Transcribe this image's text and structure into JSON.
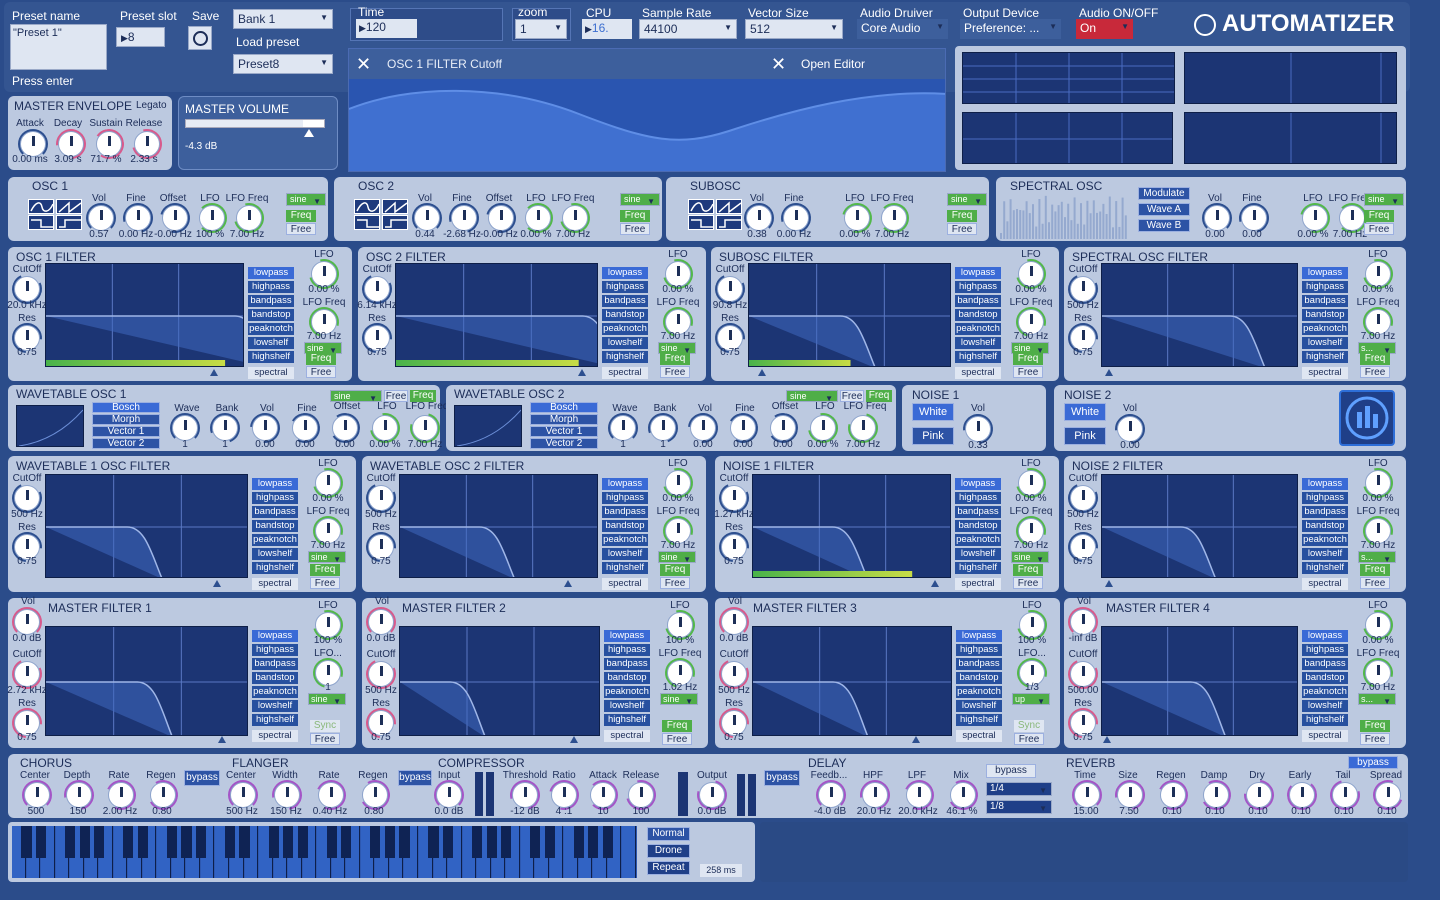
{
  "colors": {
    "bg": "#2b4c8a",
    "panel": "#bcc9e0",
    "accent_green": "#52b84a",
    "accent_pink": "#d85a8c",
    "accent_purple": "#a455c7",
    "graph": "#1c3574"
  },
  "top": {
    "preset_name_label": "Preset name",
    "preset_name_value": "\"Preset 1\"",
    "press_enter": "Press enter",
    "preset_slot_label": "Preset slot",
    "preset_slot_value": "8",
    "save_label": "Save",
    "bank_value": "Bank 1",
    "load_preset_label": "Load preset",
    "preset_value": "Preset8",
    "time_label": "Time",
    "time_value": "120",
    "zoom_label": "zoom",
    "zoom_value": "1",
    "cpu_label": "CPU",
    "cpu_value": "16.",
    "sample_rate_label": "Sample Rate",
    "sample_rate_value": "44100",
    "vector_size_label": "Vector Size",
    "vector_size_value": "512",
    "audio_driver_label": "Audio Druiver",
    "audio_driver_value": "Core Audio",
    "output_device_label": "Output Device",
    "output_device_value": "Preference: ...",
    "audio_onoff_label": "Audio ON/OFF",
    "audio_onoff_value": "On",
    "app_title": "AUTOMATIZER"
  },
  "editor": {
    "param_name": "OSC 1 FILTER Cutoff",
    "open_editor": "Open Editor"
  },
  "master_envelope": {
    "title": "MASTER ENVELOPE",
    "mode": "Legato",
    "knobs": [
      {
        "label": "Attack",
        "value": "0.00 ms"
      },
      {
        "label": "Decay",
        "value": "3.09 s"
      },
      {
        "label": "Sustain",
        "value": "71.7 %"
      },
      {
        "label": "Release",
        "value": "2.33 s"
      }
    ]
  },
  "master_volume": {
    "title": "MASTER VOLUME",
    "value": "-4.3 dB",
    "level": 0.85
  },
  "osc": [
    {
      "title": "OSC 1",
      "labels": [
        "Vol",
        "Fine",
        "Offset",
        "LFO",
        "LFO Freq"
      ],
      "values": [
        "0.57",
        "0.00 Hz",
        "-0.00 Hz",
        "100 %",
        "7.00 Hz"
      ],
      "wave": "sine",
      "freq": "Freq",
      "free": "Free"
    },
    {
      "title": "OSC 2",
      "labels": [
        "Vol",
        "Fine",
        "Offset",
        "LFO",
        "LFO Freq"
      ],
      "values": [
        "0.44",
        "-2.68 Hz",
        "-0.00 Hz",
        "0.00 %",
        "7.00 Hz"
      ],
      "wave": "sine",
      "freq": "Freq",
      "free": "Free"
    },
    {
      "title": "SUBOSC",
      "labels": [
        "Vol",
        "Fine",
        "LFO",
        "LFO Freq"
      ],
      "values": [
        "0.38",
        "0.00 Hz",
        "0.00 %",
        "7.00 Hz"
      ],
      "wave": "sine",
      "freq": "Freq",
      "free": "Free"
    },
    {
      "title": "SPECTRAL OSC",
      "labels": [
        "Vol",
        "Fine",
        "LFO",
        "LFO Freq"
      ],
      "values": [
        "0.00",
        "0.00",
        "0.00 %",
        "7.00 Hz"
      ],
      "wave": "sine",
      "freq": "Freq",
      "free": "Free",
      "buttons": [
        "Modulate",
        "Wave A",
        "Wave B"
      ]
    }
  ],
  "filter_types": [
    "lowpass",
    "highpass",
    "bandpass",
    "bandstop",
    "peaknotch",
    "lowshelf",
    "highshelf",
    "spectral"
  ],
  "filters_row1": [
    {
      "title": "OSC 1 FILTER",
      "cutoff_label": "CutOff",
      "cutoff": "20.0 kHz",
      "res_label": "Res",
      "res": "0.75",
      "lfo_label": "LFO",
      "lfo": "0.00 %",
      "lfo_freq_label": "LFO Freq",
      "lfo_freq": "7.00 Hz",
      "wave": "sine",
      "freq": "Freq",
      "free": "Free"
    },
    {
      "title": "OSC 2 FILTER",
      "cutoff_label": "CutOff",
      "cutoff": "6.14 kHz",
      "res_label": "Res",
      "res": "0.75",
      "lfo_label": "LFO",
      "lfo": "0.00 %",
      "lfo_freq_label": "LFO Freq",
      "lfo_freq": "7.00 Hz",
      "wave": "sine",
      "freq": "Freq",
      "free": "Free"
    },
    {
      "title": "SUBOSC  FILTER",
      "cutoff_label": "CutOff",
      "cutoff": "90.8 Hz",
      "res_label": "Res",
      "res": "0.75",
      "lfo_label": "LFO",
      "lfo": "0.00 %",
      "lfo_freq_label": "LFO Freq",
      "lfo_freq": "7.00 Hz",
      "wave": "sine",
      "freq": "Freq",
      "free": "Free"
    },
    {
      "title": "SPECTRAL OSC FILTER",
      "cutoff_label": "CutOff",
      "cutoff": "500 Hz",
      "res_label": "Res",
      "res": "0.75",
      "lfo_label": "LFO",
      "lfo": "0.00 %",
      "lfo_freq_label": "LFO Freq",
      "lfo_freq": "7.00 Hz",
      "wave": "s...",
      "freq": "Freq",
      "free": "Free"
    }
  ],
  "wavetables": [
    {
      "title": "WAVETABLE OSC 1",
      "tables": [
        "Bosch",
        "Morph",
        "Vector 1",
        "Vector 2"
      ],
      "labels": [
        "Wave",
        "Bank",
        "Vol",
        "Fine",
        "Offset",
        "LFO",
        "LFO Freq"
      ],
      "values": [
        "1",
        "1",
        "0.00",
        "0.00",
        "0.00",
        "0.00 %",
        "7.00 Hz"
      ],
      "wave": "sine",
      "free": "Free",
      "freq": "Freq"
    },
    {
      "title": "WAVETABLE OSC 2",
      "tables": [
        "Bosch",
        "Morph",
        "Vector 1",
        "Vector 2"
      ],
      "labels": [
        "Wave",
        "Bank",
        "Vol",
        "Fine",
        "Offset",
        "LFO",
        "LFO Freq"
      ],
      "values": [
        "1",
        "1",
        "0.00",
        "0.00",
        "0.00",
        "0.00 %",
        "7.00 Hz"
      ],
      "wave": "sine",
      "free": "Free",
      "freq": "Freq"
    }
  ],
  "noise": [
    {
      "title": "NOISE 1",
      "white": "White",
      "pink": "Pink",
      "vol_label": "Vol",
      "vol": "0.33"
    },
    {
      "title": "NOISE 2",
      "white": "White",
      "pink": "Pink",
      "vol_label": "Vol",
      "vol": "0.00"
    }
  ],
  "filters_row2": [
    {
      "title": "WAVETABLE 1 OSC  FILTER",
      "cutoff_label": "CutOff",
      "cutoff": "500 Hz",
      "res_label": "Res",
      "res": "0.75",
      "lfo_label": "LFO",
      "lfo": "0.00 %",
      "lfo_freq_label": "LFO Freq",
      "lfo_freq": "7.00 Hz",
      "wave": "sine",
      "freq": "Freq",
      "free": "Free"
    },
    {
      "title": "WAVETABLE OSC  2 FILTER",
      "cutoff_label": "CutOff",
      "cutoff": "500 Hz",
      "res_label": "Res",
      "res": "0.75",
      "lfo_label": "LFO",
      "lfo": "0.00 %",
      "lfo_freq_label": "LFO Freq",
      "lfo_freq": "7.00 Hz",
      "wave": "sine",
      "freq": "Freq",
      "free": "Free"
    },
    {
      "title": "NOISE 1 FILTER",
      "cutoff_label": "CutOff",
      "cutoff": "1.27 kHz",
      "res_label": "Res",
      "res": "0.75",
      "lfo_label": "LFO",
      "lfo": "0.00 %",
      "lfo_freq_label": "LFO Freq",
      "lfo_freq": "7.00 Hz",
      "wave": "sine",
      "freq": "Freq",
      "free": "Free"
    },
    {
      "title": "NOISE 2 FILTER",
      "cutoff_label": "CutOff",
      "cutoff": "500 Hz",
      "res_label": "Res",
      "res": "0.75",
      "lfo_label": "LFO",
      "lfo": "0.00 %",
      "lfo_freq_label": "LFO Freq",
      "lfo_freq": "7.00 Hz",
      "wave": "s...",
      "freq": "Freq",
      "free": "Free"
    }
  ],
  "master_filters": [
    {
      "title": "MASTER FILTER 1",
      "vol_label": "Vol",
      "vol": "0.0 dB",
      "cutoff_label": "CutOff",
      "cutoff": "2.72 kHz",
      "res_label": "Res",
      "res": "0.75",
      "lfo_label": "LFO",
      "lfo": "100 %",
      "lfo_freq_label": "LFO...",
      "lfo_freq": "1",
      "wave": "sine",
      "sync": "Sync",
      "free": "Free"
    },
    {
      "title": "MASTER FILTER 2",
      "vol_label": "Vol",
      "vol": "0.0 dB",
      "cutoff_label": "CutOff",
      "cutoff": "500 Hz",
      "res_label": "Res",
      "res": "0.75",
      "lfo_label": "LFO",
      "lfo": "100 %",
      "lfo_freq_label": "LFO Freq",
      "lfo_freq": "1.02 Hz",
      "wave": "sine",
      "sync": "Freq",
      "free": "Free"
    },
    {
      "title": "MASTER FILTER 3",
      "vol_label": "Vol",
      "vol": "0.0 dB",
      "cutoff_label": "CutOff",
      "cutoff": "500 Hz",
      "res_label": "Res",
      "res": "0.75",
      "lfo_label": "LFO",
      "lfo": "100 %",
      "lfo_freq_label": "LFO...",
      "lfo_freq": "1/3",
      "wave": "up",
      "sync": "Sync",
      "free": "Free"
    },
    {
      "title": "MASTER FILTER 4",
      "vol_label": "Vol",
      "vol": "-inf dB",
      "cutoff_label": "CutOff",
      "cutoff": "500.00",
      "res_label": "Res",
      "res": "0.75",
      "lfo_label": "LFO",
      "lfo": "0.00 %",
      "lfo_freq_label": "LFO Freq",
      "lfo_freq": "7.00 Hz",
      "wave": "s...",
      "sync": "Freq",
      "free": "Free"
    }
  ],
  "effects": {
    "chorus": {
      "title": "CHORUS",
      "labels": [
        "Center",
        "Depth",
        "Rate",
        "Regen"
      ],
      "values": [
        "500",
        "150",
        "2.00 Hz",
        "0.80"
      ],
      "bypass": "bypass"
    },
    "flanger": {
      "title": "FLANGER",
      "labels": [
        "Center",
        "Width",
        "Rate",
        "Regen"
      ],
      "values": [
        "500 Hz",
        "150 Hz",
        "0.40 Hz",
        "0.80"
      ],
      "bypass": "bypass"
    },
    "compressor": {
      "title": "COMPRESSOR",
      "labels": [
        "Input",
        "Threshold",
        "Ratio",
        "Attack",
        "Release",
        "Output"
      ],
      "values": [
        "0.0 dB",
        "-12 dB",
        "4 :1",
        "10",
        "100",
        "0.0 dB"
      ],
      "bypass": "bypass"
    },
    "delay": {
      "title": "DELAY",
      "labels": [
        "Feedb...",
        "HPF",
        "LPF",
        "Mix"
      ],
      "values": [
        "-4.0 dB",
        "20.0 Hz",
        "20.0 kHz",
        "46.1 %"
      ],
      "bypass": "bypass",
      "div1": "1/4",
      "div2": "1/8"
    },
    "reverb": {
      "title": "REVERB",
      "labels": [
        "Time",
        "Size",
        "Regen",
        "Damp",
        "Dry",
        "Early",
        "Tail",
        "Spread"
      ],
      "values": [
        "15.00",
        "7.50",
        "0.10",
        "0.10",
        "0.10",
        "0.10",
        "0.10",
        "0.10"
      ],
      "bypass": "bypass"
    }
  },
  "keyboard": {
    "normal": "Normal",
    "drone": "Drone",
    "repeat": "Repeat",
    "time": "258 ms"
  }
}
